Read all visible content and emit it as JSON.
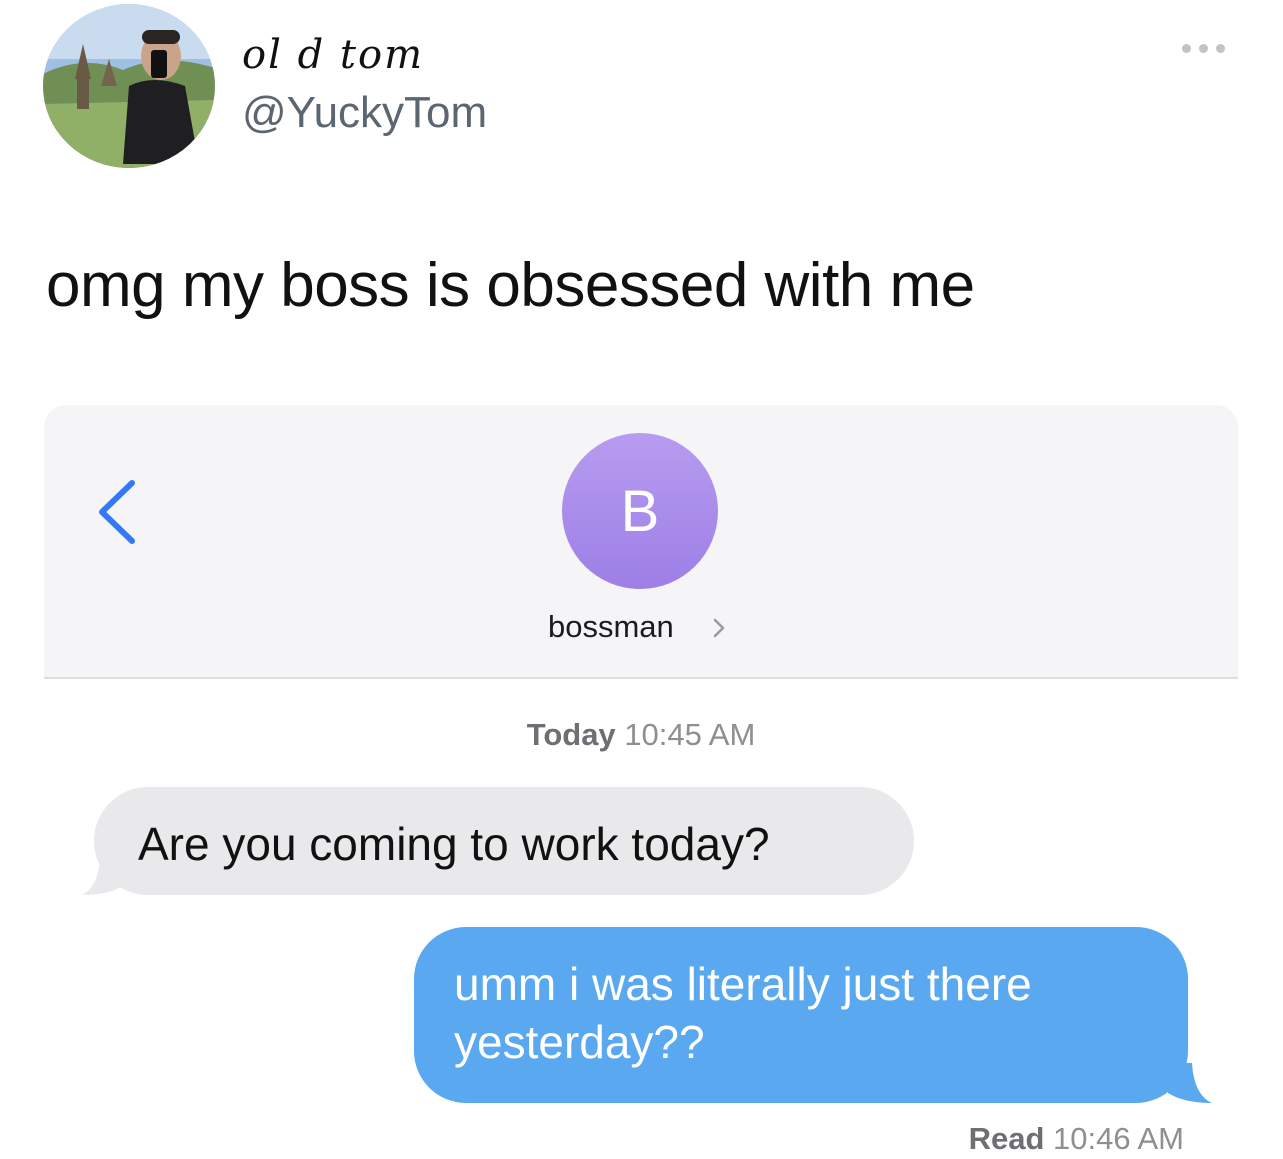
{
  "tweet": {
    "display_name": "ol d tom",
    "handle": "@YuckyTom",
    "text": "omg my boss is obsessed with me",
    "more_icon": "ellipsis-icon"
  },
  "messages_screenshot": {
    "back_icon": "chevron-left-icon",
    "contact": {
      "initial": "B",
      "name": "bossman",
      "chevron_icon": "chevron-right-icon"
    },
    "timestamp_day": "Today",
    "timestamp_time": "10:45 AM",
    "incoming_message": "Are you coming to work today?",
    "outgoing_message_line1": "umm i was literally just there",
    "outgoing_message_line2": "yesterday??",
    "read_label": "Read",
    "read_time": "10:46 AM"
  },
  "colors": {
    "incoming_bubble": "#e9e9eb",
    "outgoing_bubble": "#5aa9f0",
    "avatar_purple": "#a88bea",
    "ios_blue": "#3478f6"
  }
}
